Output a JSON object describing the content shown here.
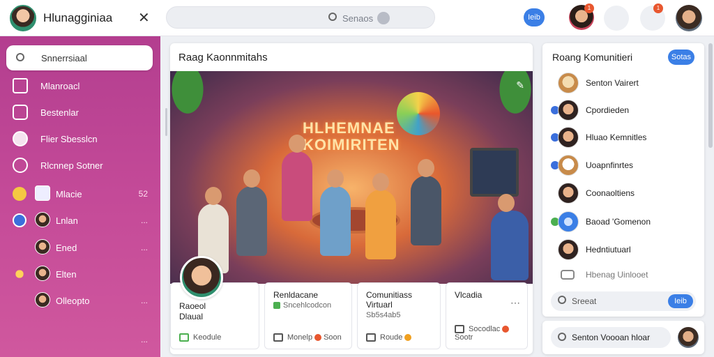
{
  "app": {
    "title": "Hlunagginiaa"
  },
  "top": {
    "search_placeholder": "Senaos",
    "pill_label": "Ieib",
    "badges": [
      "1",
      "1"
    ]
  },
  "sidebar": {
    "search_value": "Snnerrsiaal",
    "items": [
      {
        "label": "Mlanroacl",
        "icon": "home-icon"
      },
      {
        "label": "Bestenlar",
        "icon": "square-icon"
      },
      {
        "label": "Flier Sbesslcn",
        "icon": "heart-icon"
      },
      {
        "label": "Rlcnnep Sotner",
        "icon": "chat-icon"
      },
      {
        "label": "Mlacie",
        "meta": "52",
        "icon": "star-icon"
      },
      {
        "label": "Lnlan",
        "meta": "...",
        "icon": "chat-bubble-icon"
      },
      {
        "label": "Ened",
        "meta": "...",
        "icon": "avatar-icon"
      },
      {
        "label": "Elten",
        "meta": "",
        "icon": "sun-icon"
      },
      {
        "label": "Olleopto",
        "meta": "...",
        "icon": "avatar-icon"
      }
    ],
    "extra_meta": "..."
  },
  "main": {
    "title": "Raag Kaonnmitahs",
    "hero_sign_line1": "HLHEMNAE",
    "hero_sign_line2": "KOIMIRITEN",
    "profile": {
      "name": "Raoeol",
      "sub": "Dlaual",
      "foot": "Keodule"
    },
    "cards": [
      {
        "title": "Renldacane",
        "sub": "Sncehlcodcon",
        "foot_a": "Monelp",
        "foot_b": "Soon"
      },
      {
        "title": "Comunitiass",
        "title2": "Virtuarl",
        "sub": "Sb5s4ab5",
        "foot_a": "Roude"
      },
      {
        "title": "Vlcadia",
        "foot_a": "Socodlac",
        "foot_b": "Sootr"
      }
    ]
  },
  "right": {
    "title": "Roang Komunitieri",
    "pill_label": "Sotas",
    "contacts": [
      {
        "name": "Senton Vairert"
      },
      {
        "name": "Cpordieden"
      },
      {
        "name": "Hluao Kemnitles"
      },
      {
        "name": "Uoapnfinrtes"
      },
      {
        "name": "Coonaoltiens"
      },
      {
        "name": "Baoad 'Gomenon"
      },
      {
        "name": "Hedntiutuarl"
      },
      {
        "name": "Hbenag Uinlooet"
      }
    ],
    "input_placeholder": "Sreeat",
    "send_label": "Ieib",
    "bottom_search": "Senton Voooan hloar"
  },
  "colors": {
    "sidebar_top": "#b33e8f",
    "sidebar_bottom": "#d0589e",
    "accent_blue": "#3b7fe6",
    "badge_orange": "#e8572f"
  }
}
